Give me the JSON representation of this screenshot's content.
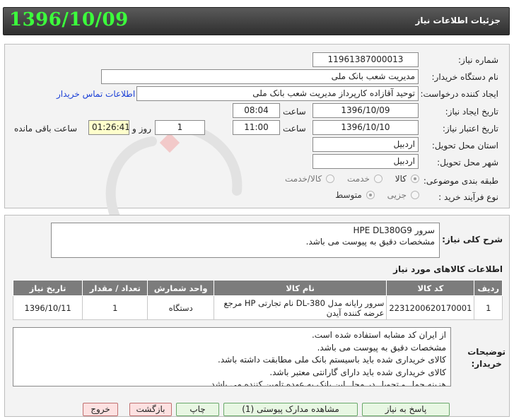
{
  "header": {
    "title": "جزئیات اطلاعات نیاز",
    "date": "1396/10/09"
  },
  "form": {
    "need_number_label": "شماره نیاز:",
    "need_number": "11961387000013",
    "buyer_org_label": "نام دستگاه خریدار:",
    "buyer_org": "مدیریت شعب بانک ملی",
    "requester_label": "ایجاد کننده درخواست:",
    "requester": "توحید آقازاده کارپرداز مدیریت شعب بانک ملی",
    "contact_link": "اطلاعات تماس خریدار",
    "creation_date_label": "تاریخ ایجاد نیاز:",
    "creation_date": "1396/10/09",
    "time_label": "ساعت",
    "creation_time": "08:04",
    "validity_date_label": "تاریخ اعتبار نیاز:",
    "validity_date": "1396/10/10",
    "validity_time": "11:00",
    "days": "1",
    "days_label": "روز و",
    "remaining_time": "01:26:41",
    "remaining_label": "ساعت باقی مانده",
    "province_label": "استان محل تحویل:",
    "province": "اردبیل",
    "city_label": "شهر محل تحویل:",
    "city": "اردبیل",
    "category_label": "طبقه بندی موضوعی:",
    "category_options": [
      "کالا",
      "خدمت",
      "کالا/خدمت"
    ],
    "category_selected": "کالا",
    "process_label": "نوع فرآیند خرید :",
    "process_options": [
      "جزیی",
      "متوسط"
    ],
    "process_selected": "متوسط"
  },
  "general_description": {
    "label": "شرح کلی نیاز:",
    "line1": "سرور  HPE DL380G9",
    "line2": "مشخصات دقیق به پیوست می باشد."
  },
  "items_section": {
    "title": "اطلاعات کالاهای مورد نیاز",
    "columns": [
      "ردیف",
      "کد کالا",
      "نام کالا",
      "واحد شمارش",
      "تعداد / مقدار",
      "تاریخ نیاز"
    ],
    "rows": [
      {
        "row": "1",
        "code": "2231200620170001",
        "name": "سرور رایانه مدل DL-380 نام تجارتی HP مرجع عرضه کننده آیدن",
        "unit": "دستگاه",
        "quantity": "1",
        "date": "1396/10/11"
      }
    ]
  },
  "buyer_notes": {
    "label_line1": "توضیحات",
    "label_line2": "خریدار:",
    "lines": [
      "از ایران کد مشابه استفاده شده است.",
      "مشخصات دقیق به پیوست می باشد.",
      "کالای خریداری شده باید باسیستم بانک ملی مطابقت داشته باشد.",
      "کالای خریداری شده باید دارای گارانتی معتبر باشد.",
      "هزینه حمل و تحویل در محل این بانک به عهده تامین کننده می باشد."
    ]
  },
  "buttons": {
    "respond": "پاسخ به نیاز",
    "view_docs": "مشاهده مدارک پیوستی (1)",
    "print": "چاپ",
    "back": "بازگشت",
    "exit": "خروج"
  },
  "colors": {
    "header_date": "#3cff3c",
    "table_header": "#7c7c7c",
    "link": "#1a3fd6"
  }
}
